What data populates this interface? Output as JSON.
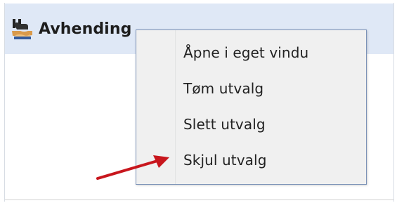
{
  "header": {
    "title": "Avhending",
    "icon": "handshake-icon"
  },
  "context_menu": {
    "items": [
      {
        "label": "Åpne i eget vindu"
      },
      {
        "label": "Tøm utvalg"
      },
      {
        "label": "Slett utvalg"
      },
      {
        "label": "Skjul utvalg"
      }
    ]
  },
  "annotation": {
    "arrow_color": "#c8161d"
  },
  "colors": {
    "header_background": "#dfe8f6",
    "menu_background": "#f0f0f0",
    "menu_border": "#7b92b7"
  }
}
